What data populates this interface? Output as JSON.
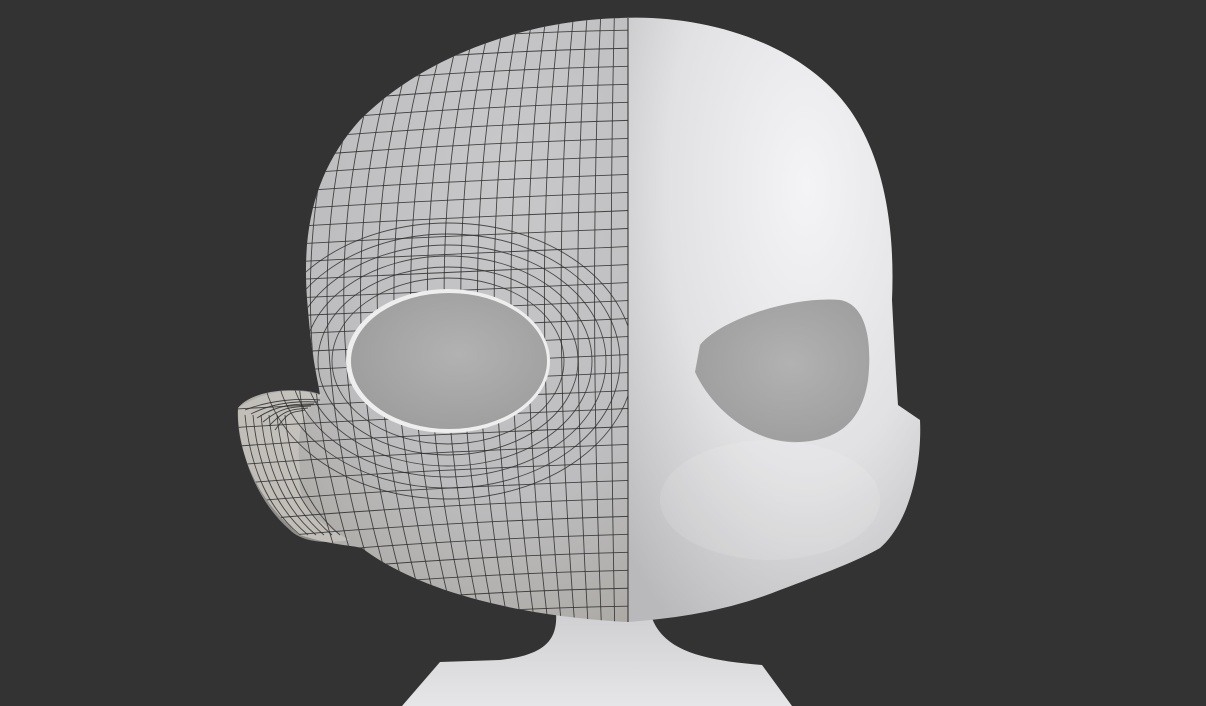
{
  "scene": {
    "background_color": "#333333",
    "mesh_color": "#d9d9d9",
    "mesh_shadow_color": "#a9a9a9",
    "wireframe_color": "#2b2b2b",
    "eye_socket_color": "#a8a8a8",
    "left_half_display": "wireframe-overlay",
    "right_half_display": "solid-smooth"
  }
}
